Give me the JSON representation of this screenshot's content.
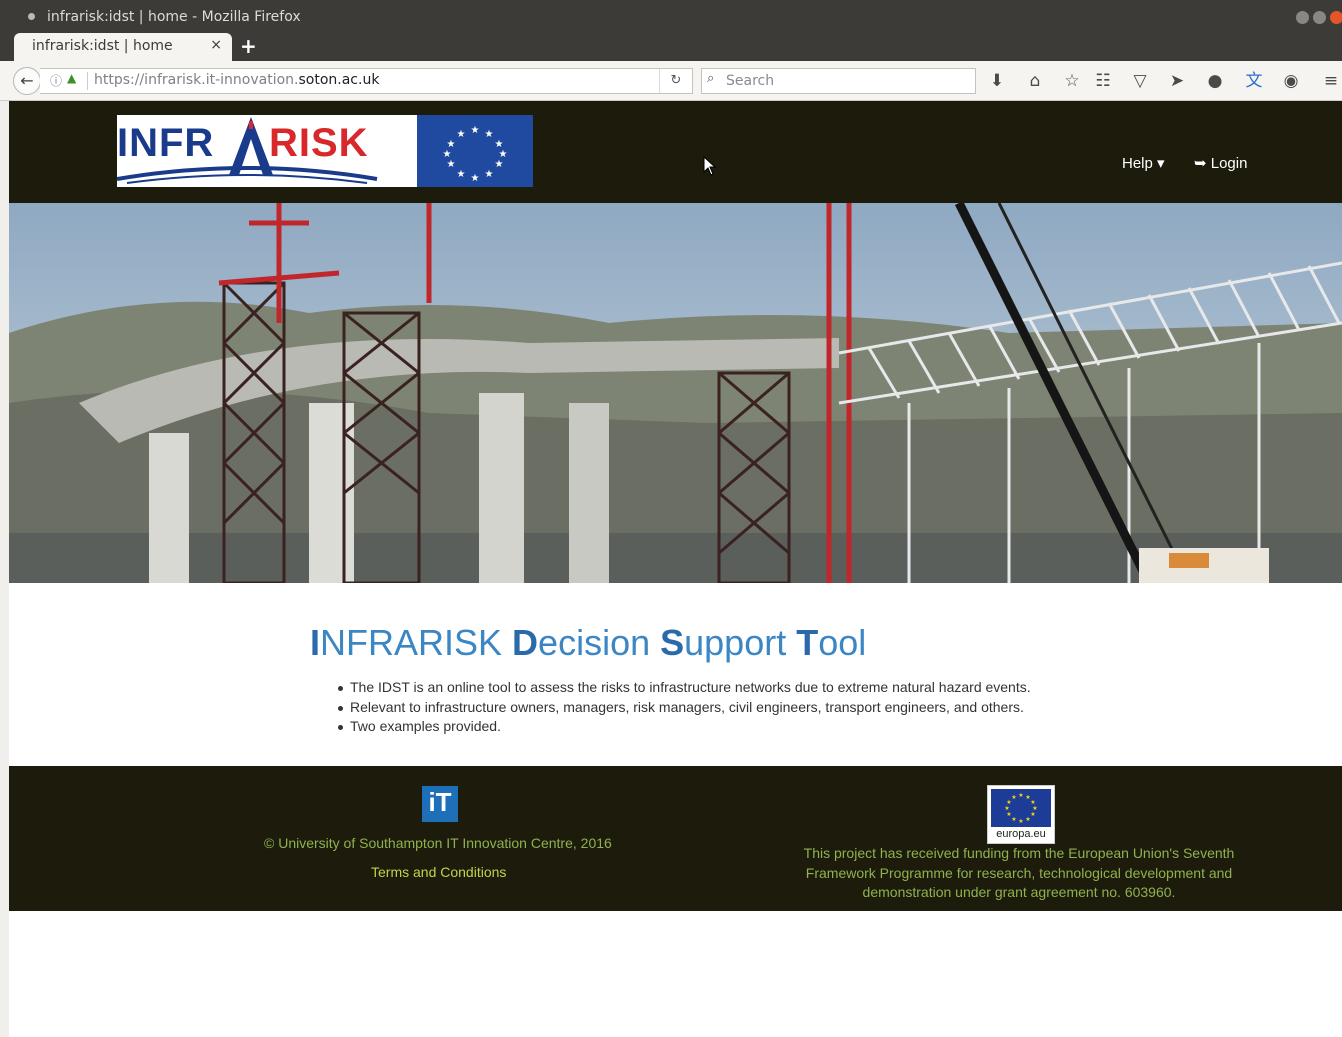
{
  "window": {
    "title": "infrarisk:idst | home - Mozilla Firefox"
  },
  "tab": {
    "label": "infrarisk:idst | home",
    "close": "×",
    "new_tab": "+"
  },
  "navbar": {
    "url_prefix": "https://infrarisk.it-innovation.",
    "url_domain": "soton.ac.uk",
    "search_placeholder": "Search"
  },
  "site": {
    "logo_text_left": "INFR",
    "logo_text_right": "RISK",
    "nav": {
      "help": "Help ▾",
      "login": "Login"
    }
  },
  "main": {
    "headline": {
      "p1_cap": "I",
      "p1_rest": "NFRARISK ",
      "p2_cap": "D",
      "p2_rest": "ecision ",
      "p3_cap": "S",
      "p3_rest": "upport ",
      "p4_cap": "T",
      "p4_rest": "ool"
    },
    "bullets": [
      "The IDST is an online tool to assess the risks to infrastructure networks due to extreme natural hazard events.",
      "Relevant to infrastructure owners, managers, risk managers, civil engineers, transport engineers, and others.",
      "Two examples provided."
    ]
  },
  "footer": {
    "it_logo": "iT",
    "copyright": "© University of Southampton IT Innovation Centre, 2016",
    "terms": "Terms and Conditions",
    "eu_label": "europa.eu",
    "funding": "This project has received funding from the European Union's Seventh Framework Programme for research, technological development and demonstration under grant agreement no. 603960."
  },
  "colors": {
    "header_bg": "#1c1b0c",
    "headline_blue": "#3b86c4",
    "footer_text": "#8fb24e",
    "eu_blue": "#1d3c98"
  }
}
